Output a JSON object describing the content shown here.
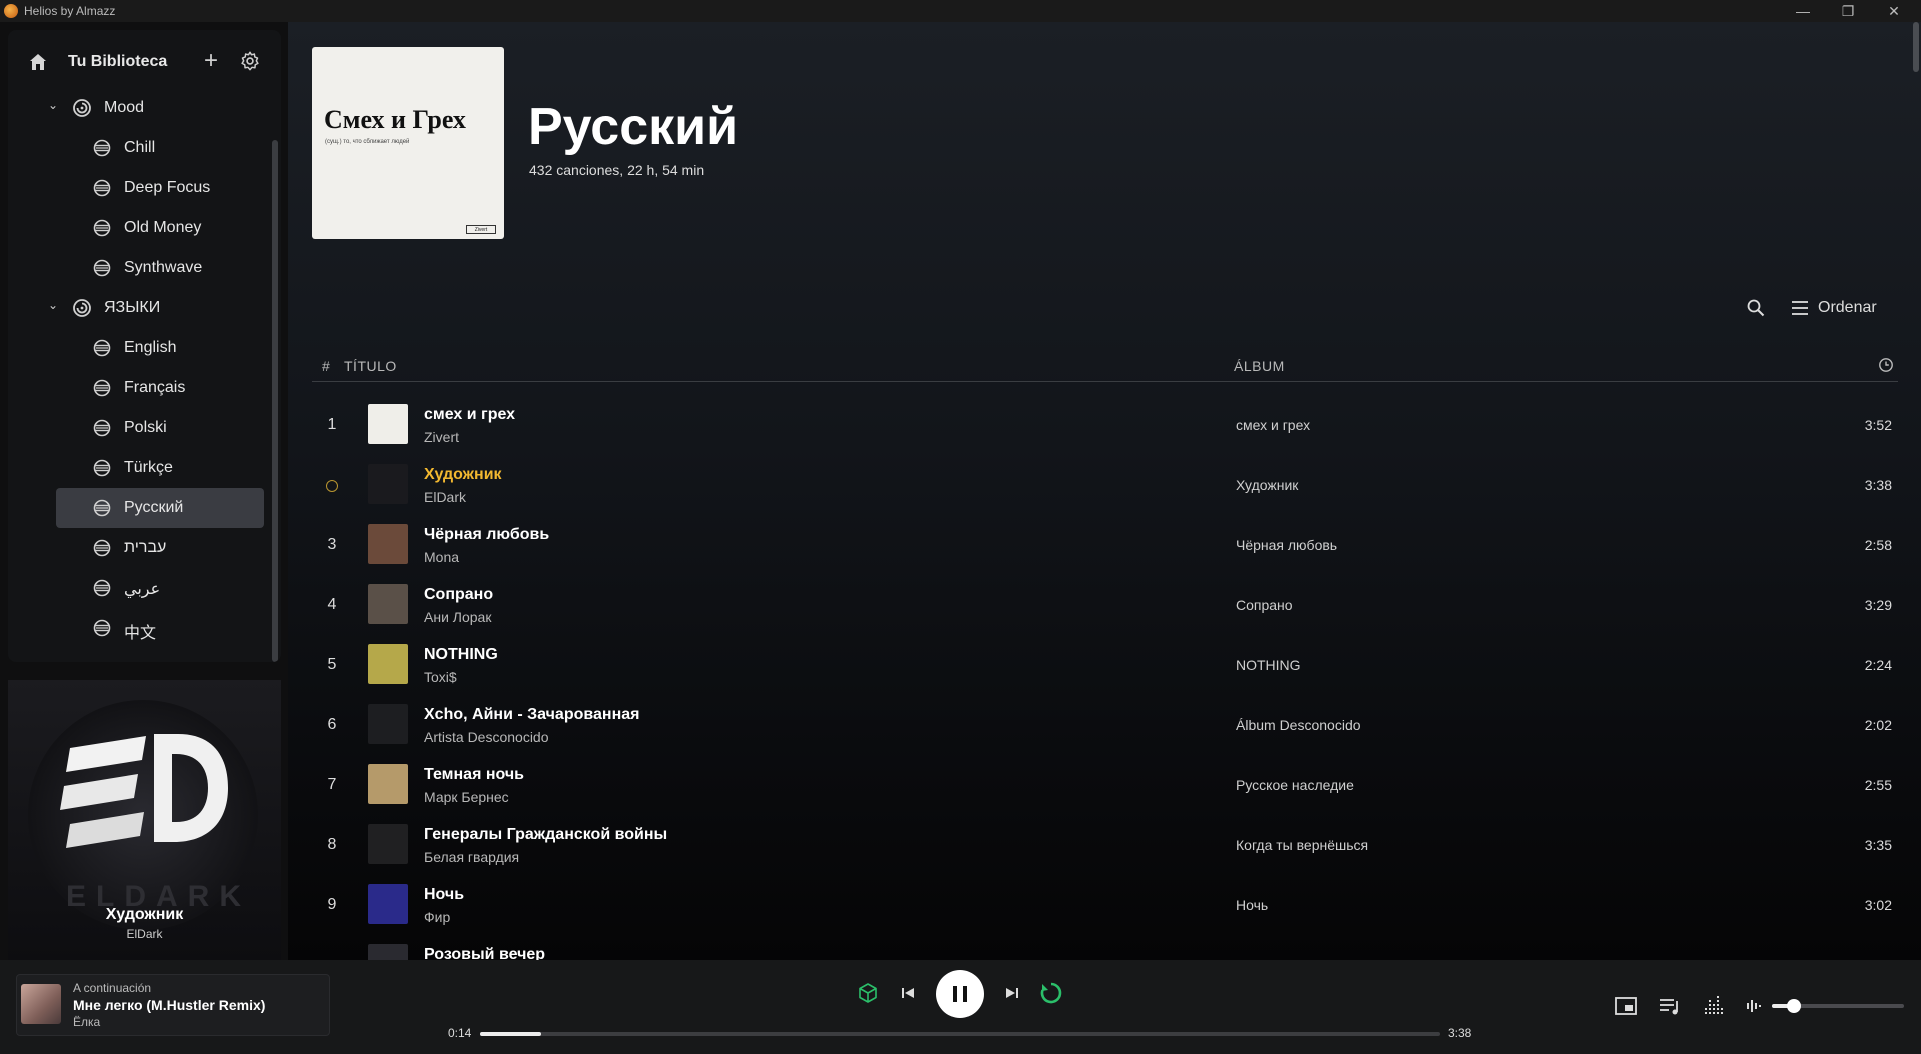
{
  "window": {
    "title": "Helios by Almazz",
    "minimize": "—",
    "restore": "❐",
    "close": "✕"
  },
  "library": {
    "title": "Tu Biblioteca",
    "add": "+",
    "folders": [
      {
        "name": "Mood",
        "items": [
          "Chill",
          "Deep Focus",
          "Old Money",
          "Synthwave"
        ]
      },
      {
        "name": "ЯЗЫКИ",
        "items": [
          "English",
          "Français",
          "Polski",
          "Türkçe",
          "Русский",
          "עברית",
          "عربي",
          "中文"
        ]
      }
    ],
    "active_item": "Русский"
  },
  "now_playing": {
    "title": "Художник",
    "artist": "ElDark",
    "art_word": "ELDARK"
  },
  "playlist": {
    "title": "Русский",
    "meta": "432 canciones, 22 h, 54 min",
    "cover_title": "Смех и Грех",
    "cover_subtitle": "(сущ.) то, что сближает людей",
    "cover_label": "Zivert",
    "sort_label": "Ordenar",
    "headers": {
      "num": "#",
      "title": "TÍTULO",
      "album": "ÁLBUM"
    },
    "tracks": [
      {
        "num": "1",
        "title": "смех и грех",
        "artist": "Zivert",
        "album": "смех и грех",
        "duration": "3:52",
        "thumb_color": "#efeee9"
      },
      {
        "num": "",
        "title": "Художник",
        "artist": "ElDark",
        "album": "Художник",
        "duration": "3:38",
        "playing": true,
        "thumb_color": "#1a1a1e"
      },
      {
        "num": "3",
        "title": "Чёрная любовь",
        "artist": "Mona",
        "album": "Чёрная любовь",
        "duration": "2:58",
        "thumb_color": "#6b4a3a"
      },
      {
        "num": "4",
        "title": "Сопрано",
        "artist": "Ани Лорак",
        "album": "Сопрано",
        "duration": "3:29",
        "thumb_color": "#5a5048"
      },
      {
        "num": "5",
        "title": "NOTHING",
        "artist": "Toxi$",
        "album": "NOTHING",
        "duration": "2:24",
        "thumb_color": "#b5a84a"
      },
      {
        "num": "6",
        "title": "Xcho, Айни - Зачарованная",
        "artist": "Artista Desconocido",
        "album": "Álbum Desconocido",
        "duration": "2:02",
        "thumb_color": "#1d1e21"
      },
      {
        "num": "7",
        "title": "Темная ночь",
        "artist": "Марк Бернес",
        "album": "Русское наследие",
        "duration": "2:55",
        "thumb_color": "#b59a6a"
      },
      {
        "num": "8",
        "title": "Генералы Гражданской войны",
        "artist": "Белая гвардия",
        "album": "Когда ты вернёшься",
        "duration": "3:35",
        "thumb_color": "#202022"
      },
      {
        "num": "9",
        "title": "Ночь",
        "artist": "Фир",
        "album": "Ночь",
        "duration": "3:02",
        "thumb_color": "#2a2a8a"
      },
      {
        "num": "",
        "title": "Розовый вечер",
        "artist": "",
        "album": "",
        "duration": "",
        "thumb_color": "#2a2a30"
      }
    ]
  },
  "player": {
    "next_label": "A continuación",
    "next_title": "Мне легко (M.Hustler Remix)",
    "next_artist": "Ёлка",
    "current_time": "0:14",
    "total_time": "3:38",
    "progress": 0.064,
    "volume": 0.17,
    "accent": "#2bbf6a"
  }
}
